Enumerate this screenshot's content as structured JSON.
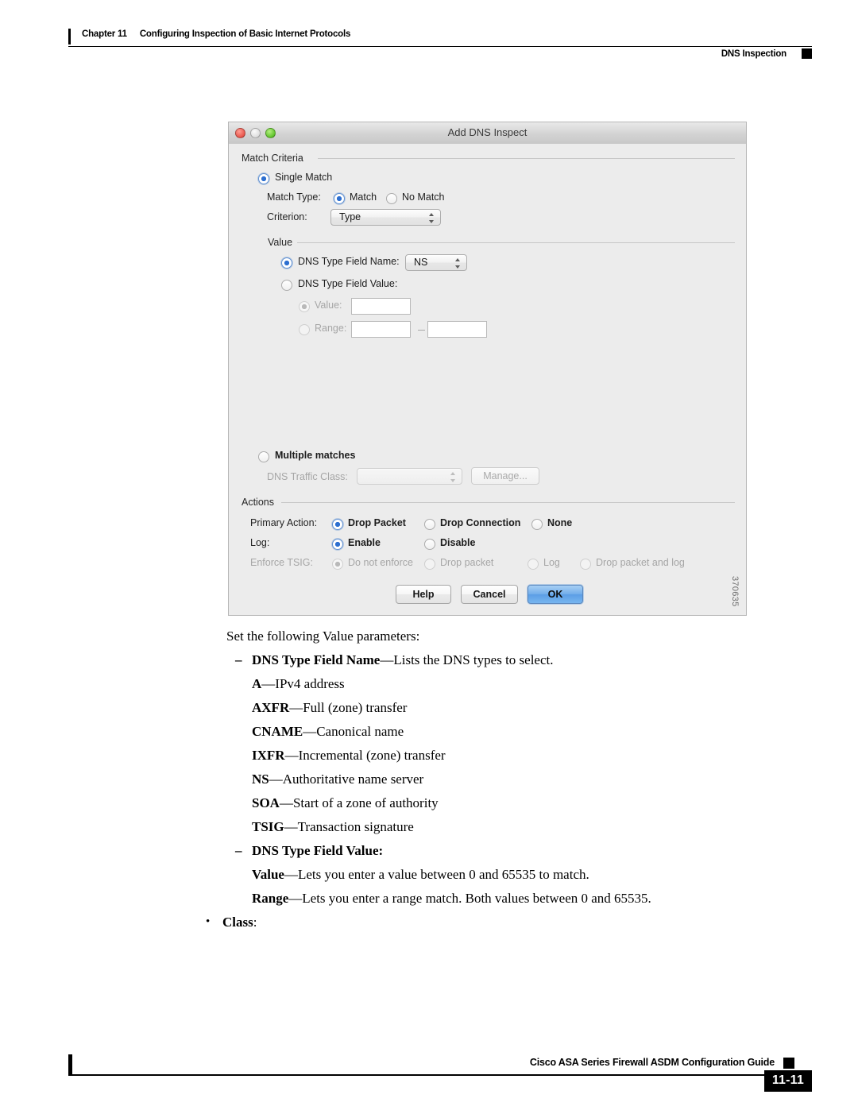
{
  "header": {
    "chapter": "Chapter 11",
    "chapter_title": "Configuring Inspection of Basic Internet Protocols",
    "section": "DNS Inspection"
  },
  "figure": {
    "id_label": "370635",
    "dialog": {
      "title": "Add DNS Inspect",
      "match_criteria": {
        "group_label": "Match Criteria",
        "single_match_label": "Single Match",
        "match_type_label": "Match Type:",
        "match_label": "Match",
        "no_match_label": "No Match",
        "criterion_label": "Criterion:",
        "criterion_value": "Type"
      },
      "value": {
        "group_label": "Value",
        "field_name_label": "DNS Type Field Name:",
        "field_name_value": "NS",
        "field_value_label": "DNS Type Field Value:",
        "value_label": "Value:",
        "value_text": "",
        "range_label": "Range:",
        "range_from": "",
        "range_to": ""
      },
      "multiple": {
        "multiple_matches_label": "Multiple matches",
        "traffic_class_label": "DNS Traffic Class:",
        "traffic_class_value": "",
        "manage_label": "Manage..."
      },
      "actions": {
        "group_label": "Actions",
        "primary_action_label": "Primary Action:",
        "drop_packet_label": "Drop Packet",
        "drop_connection_label": "Drop Connection",
        "none_label": "None",
        "log_label": "Log:",
        "enable_label": "Enable",
        "disable_label": "Disable",
        "enforce_tsig_label": "Enforce TSIG:",
        "do_not_enforce_label": "Do not enforce",
        "tsig_drop_packet_label": "Drop packet",
        "tsig_log_label": "Log",
        "tsig_drop_packet_and_log_label": "Drop packet and log"
      },
      "buttons": {
        "help": "Help",
        "cancel": "Cancel",
        "ok": "OK"
      },
      "accent_color": "#5c9ee6"
    }
  },
  "body": {
    "intro": "Set the following Value parameters:",
    "items": [
      {
        "marker": "–",
        "bold": "DNS Type Field Name",
        "rest": "—Lists the DNS types to select."
      },
      {
        "marker": "",
        "bold": "A",
        "rest": "—IPv4 address"
      },
      {
        "marker": "",
        "bold": "AXFR",
        "rest": "—Full (zone) transfer"
      },
      {
        "marker": "",
        "bold": "CNAME",
        "rest": "—Canonical name"
      },
      {
        "marker": "",
        "bold": "IXFR",
        "rest": "—Incremental (zone) transfer"
      },
      {
        "marker": "",
        "bold": "NS",
        "rest": "—Authoritative name server"
      },
      {
        "marker": "",
        "bold": "SOA",
        "rest": "—Start of a zone of authority"
      },
      {
        "marker": "",
        "bold": "TSIG",
        "rest": "—Transaction signature"
      },
      {
        "marker": "–",
        "bold": "DNS Type Field Value:",
        "rest": ""
      },
      {
        "marker": "",
        "bold": "Value",
        "rest": "—Lets you enter a value between 0 and 65535 to match."
      },
      {
        "marker": "",
        "bold": "Range",
        "rest": "—Lets you enter a range match. Both values between 0 and 65535."
      },
      {
        "marker": "•",
        "bold": "Class",
        "rest": ":"
      }
    ]
  },
  "footer": {
    "guide_title": "Cisco ASA Series Firewall ASDM Configuration Guide",
    "page_number": "11-11"
  }
}
